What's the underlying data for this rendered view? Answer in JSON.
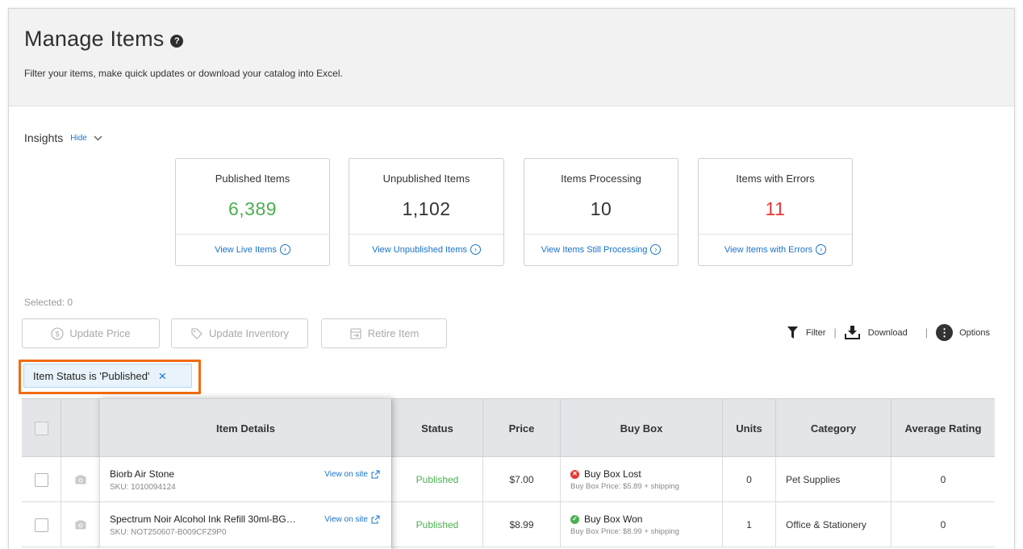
{
  "header": {
    "title": "Manage Items",
    "help_glyph": "?",
    "subtitle": "Filter your items, make quick updates or download your catalog into Excel."
  },
  "insights": {
    "label": "Insights",
    "hide_label": "Hide",
    "cards": [
      {
        "title": "Published Items",
        "value": "6,389",
        "value_color": "#4caf50",
        "link": "View Live Items"
      },
      {
        "title": "Unpublished Items",
        "value": "1,102",
        "value_color": "#333333",
        "link": "View Unpublished Items"
      },
      {
        "title": "Items Processing",
        "value": "10",
        "value_color": "#333333",
        "link": "View Items Still Processing"
      },
      {
        "title": "Items with Errors",
        "value": "11",
        "value_color": "#e53935",
        "link": "View Items with Errors"
      }
    ]
  },
  "selection": {
    "label": "Selected: 0"
  },
  "actions": {
    "update_price": "Update Price",
    "update_inventory": "Update Inventory",
    "retire_item": "Retire Item"
  },
  "toolbar": {
    "filter": "Filter",
    "download": "Download",
    "options": "Options",
    "separator": "|"
  },
  "active_filter": {
    "label": "Item Status is 'Published'",
    "close_glyph": "×"
  },
  "table": {
    "columns": [
      "Item Details",
      "Status",
      "Price",
      "Buy Box",
      "Units",
      "Category",
      "Average Rating"
    ],
    "rows": [
      {
        "name": "Biorb Air Stone",
        "sku": "SKU: 1010094124",
        "view_link": "View on site",
        "status": "Published",
        "price": "$7.00",
        "buybox_title": "Buy Box Lost",
        "buybox_state": "lost",
        "buybox_sub": "Buy Box Price: $5.89 + shipping",
        "units": "0",
        "category": "Pet Supplies",
        "rating": "0"
      },
      {
        "name": "Spectrum Noir Alcohol Ink Refill 30ml-BG…",
        "sku": "SKU: NOT250607-B009CFZ9P0",
        "view_link": "View on site",
        "status": "Published",
        "price": "$8.99",
        "buybox_title": "Buy Box Won",
        "buybox_state": "won",
        "buybox_sub": "Buy Box Price: $8.99 + shipping",
        "units": "1",
        "category": "Office & Stationery",
        "rating": "0"
      }
    ]
  },
  "colors": {
    "accent": "#1a73c8",
    "highlight": "#f26b10",
    "success": "#4caf50",
    "error": "#e53935"
  }
}
